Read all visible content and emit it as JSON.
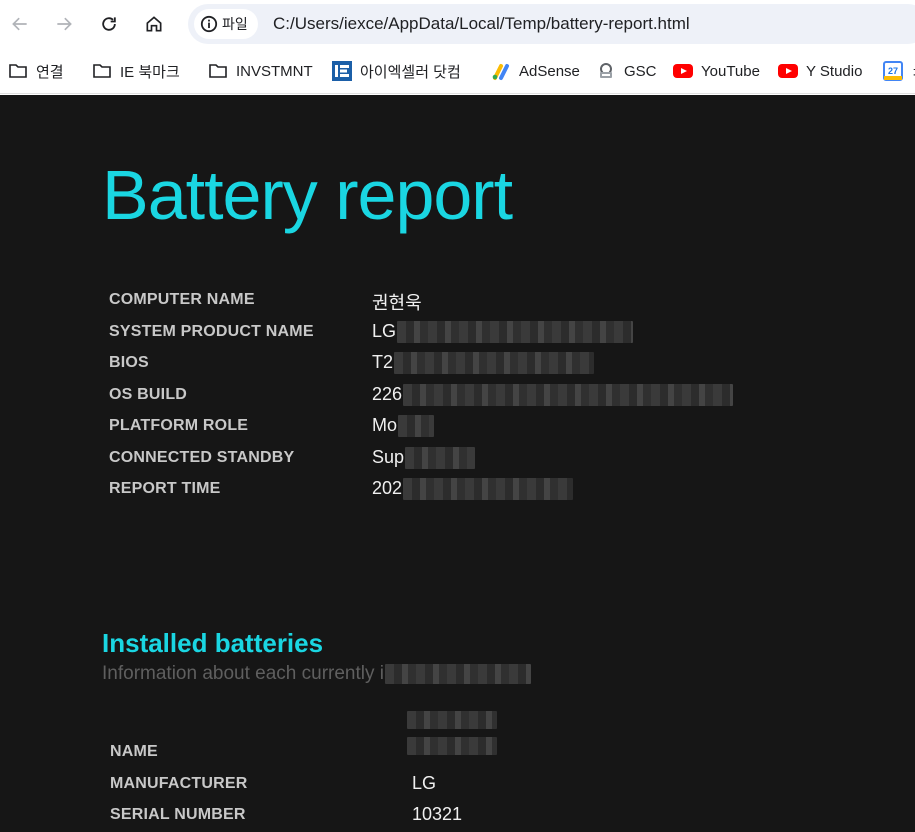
{
  "browser": {
    "site_chip_label": "파일",
    "url": "C:/Users/iexce/AppData/Local/Temp/battery-report.html"
  },
  "bookmarks": [
    {
      "label": "연결",
      "icon": "folder-icon"
    },
    {
      "label": "IE 북마크",
      "icon": "folder-icon"
    },
    {
      "label": "INVSTMNT",
      "icon": "folder-icon"
    },
    {
      "label": "아이엑셀러 닷컴",
      "icon": "ie-logo-icon"
    },
    {
      "label": "AdSense",
      "icon": "adsense-icon"
    },
    {
      "label": "GSC",
      "icon": "gsc-icon"
    },
    {
      "label": "YouTube",
      "icon": "youtube-icon"
    },
    {
      "label": "Y Studio",
      "icon": "youtube-icon"
    },
    {
      "label": "ㅊ",
      "icon": "calendar-icon"
    }
  ],
  "report": {
    "title": "Battery report",
    "fields": [
      {
        "label": "COMPUTER NAME",
        "value": "권현욱"
      },
      {
        "label": "SYSTEM PRODUCT NAME",
        "value": "LG"
      },
      {
        "label": "BIOS",
        "value": "T2"
      },
      {
        "label": "OS BUILD",
        "value": "226"
      },
      {
        "label": "PLATFORM ROLE",
        "value": "Mo"
      },
      {
        "label": "CONNECTED STANDBY",
        "value": "Sup"
      },
      {
        "label": "REPORT TIME",
        "value": "202"
      }
    ]
  },
  "installed_batteries": {
    "title": "Installed batteries",
    "subtitle": "Information about each currently i",
    "fields": [
      {
        "label": "NAME",
        "value": ""
      },
      {
        "label": "MANUFACTURER",
        "value": "LG"
      },
      {
        "label": "SERIAL NUMBER",
        "value": "10321"
      }
    ]
  },
  "colors": {
    "accent": "#1ad6e2",
    "page_background": "#161616"
  }
}
